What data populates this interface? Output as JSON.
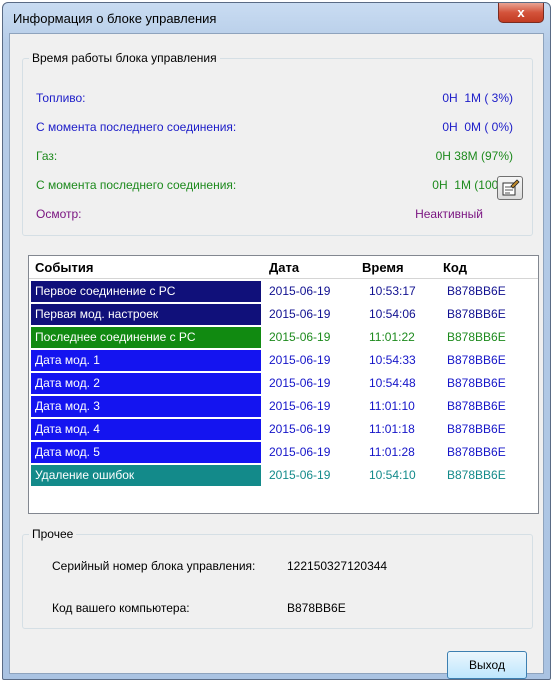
{
  "window": {
    "title": "Информация о блоке управления",
    "close_glyph": "x"
  },
  "uptime": {
    "legend": "Время работы блока управления",
    "rows": [
      {
        "label": "Топливо:",
        "value": "0H  1M ( 3%)",
        "color": "#1c1cc8"
      },
      {
        "label": "С момента последнего соединения:",
        "value": "0H  0M ( 0%)",
        "color": "#1c1cc8"
      },
      {
        "label": "Газ:",
        "value": "0H 38M (97%)",
        "color": "#1d8a1d"
      },
      {
        "label": "С момента последнего соединения:",
        "value": "0H  1M (100%)",
        "color": "#1d8a1d"
      },
      {
        "label": "Осмотр:",
        "value": "Неактивный",
        "color": "#7b1682"
      }
    ],
    "edit_icon": "edit-icon"
  },
  "events": {
    "headers": {
      "event": "События",
      "date": "Дата",
      "time": "Время",
      "code": "Код"
    },
    "rows": [
      {
        "event": "Первое соединение с PC",
        "date": "2015-06-19",
        "time": "10:53:17",
        "code": "B878BB6E",
        "bg": "#10107a",
        "fg": "#101090"
      },
      {
        "event": "Первая мод. настроек",
        "date": "2015-06-19",
        "time": "10:54:06",
        "code": "B878BB6E",
        "bg": "#10107a",
        "fg": "#101090"
      },
      {
        "event": "Последнее соединение с PC",
        "date": "2015-06-19",
        "time": "11:01:22",
        "code": "B878BB6E",
        "bg": "#118a11",
        "fg": "#1d8a1d"
      },
      {
        "event": "Дата мод. 1",
        "date": "2015-06-19",
        "time": "10:54:33",
        "code": "B878BB6E",
        "bg": "#1414f0",
        "fg": "#1414c8"
      },
      {
        "event": "Дата мод. 2",
        "date": "2015-06-19",
        "time": "10:54:48",
        "code": "B878BB6E",
        "bg": "#1414f0",
        "fg": "#1414c8"
      },
      {
        "event": "Дата мод. 3",
        "date": "2015-06-19",
        "time": "11:01:10",
        "code": "B878BB6E",
        "bg": "#1414f0",
        "fg": "#1414c8"
      },
      {
        "event": "Дата мод. 4",
        "date": "2015-06-19",
        "time": "11:01:18",
        "code": "B878BB6E",
        "bg": "#1414f0",
        "fg": "#1414c8"
      },
      {
        "event": "Дата мод. 5",
        "date": "2015-06-19",
        "time": "11:01:28",
        "code": "B878BB6E",
        "bg": "#1414f0",
        "fg": "#1414c8"
      },
      {
        "event": "Удаление ошибок",
        "date": "2015-06-19",
        "time": "10:54:10",
        "code": "B878BB6E",
        "bg": "#138a8a",
        "fg": "#138a8a"
      }
    ]
  },
  "other": {
    "legend": "Прочее",
    "serial_label": "Серийный номер блока управления:",
    "serial_value": "122150327120344",
    "pc_code_label": "Код вашего компьютера:",
    "pc_code_value": "B878BB6E"
  },
  "buttons": {
    "exit": "Выход"
  }
}
